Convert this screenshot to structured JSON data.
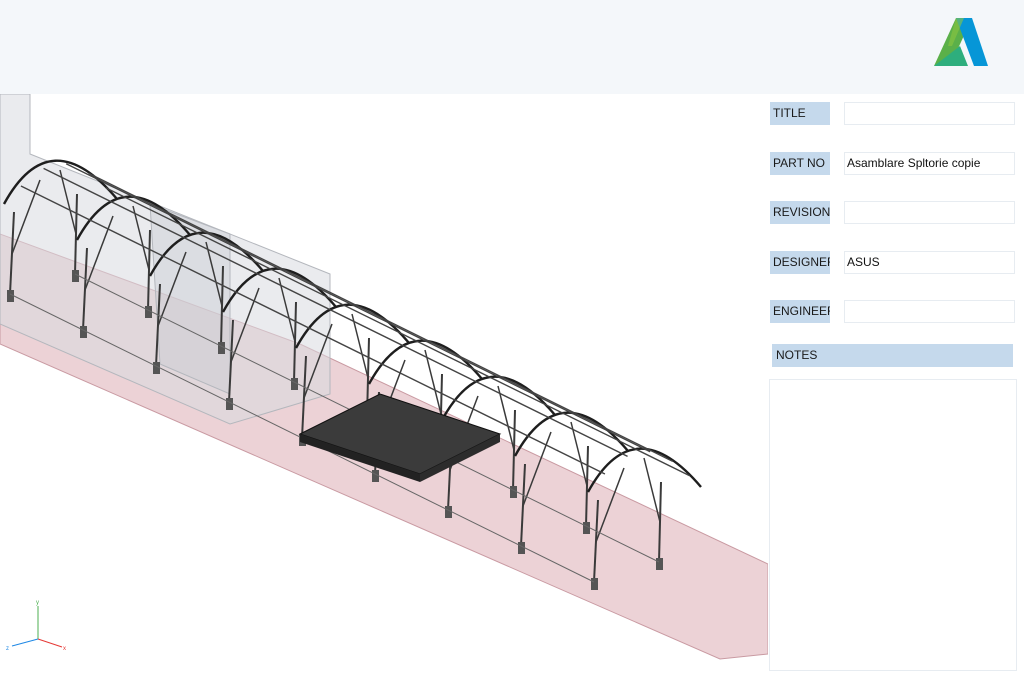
{
  "header": {
    "logo_icon": "autodesk-logo-icon"
  },
  "properties": [
    {
      "label": "TITLE",
      "value": ""
    },
    {
      "label": "PART NO",
      "value": "Asamblare Spltorie copie"
    },
    {
      "label": "REVISION",
      "value": ""
    },
    {
      "label": "DESIGNER",
      "value": "ASUS"
    },
    {
      "label": "ENGINEER",
      "value": ""
    }
  ],
  "notes": {
    "label": "NOTES",
    "value": ""
  },
  "axis_triad": {
    "x": "x",
    "y": "y",
    "z": "z"
  },
  "colors": {
    "header_bg": "#f4f7fa",
    "label_bg": "#c5d9ec",
    "floor_pink": "#e8c7cc",
    "steel": "#3a3a3a",
    "platform": "#3c3c3c"
  }
}
